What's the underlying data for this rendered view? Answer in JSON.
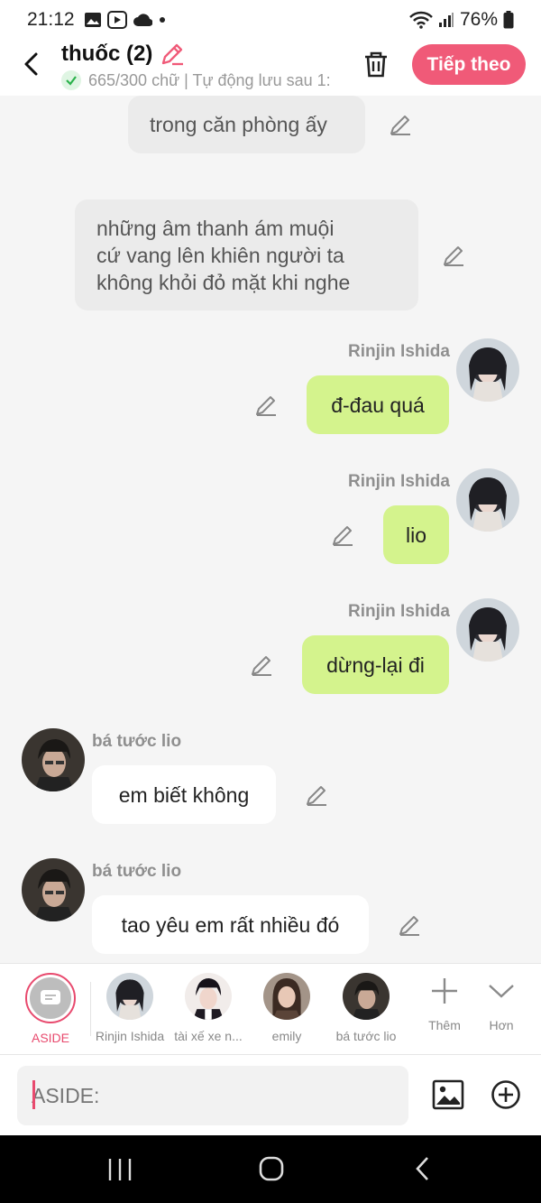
{
  "status": {
    "time": "21:12",
    "battery": "76%"
  },
  "header": {
    "title": "thuốc (2)",
    "subtitle": "665/300 chữ | Tự động lưu sau 1:",
    "next_label": "Tiếp theo"
  },
  "messages": {
    "m1": {
      "text": "trong căn phòng ấy"
    },
    "m2": {
      "lines": [
        "những âm thanh ám muội",
        "cứ vang lên khiên người ta",
        "không khỏi đỏ mặt khi nghe"
      ]
    },
    "m3": {
      "name": "Rinjin Ishida",
      "text": "đ-đau quá"
    },
    "m4": {
      "name": "Rinjin Ishida",
      "text": "lio"
    },
    "m5": {
      "name": "Rinjin Ishida",
      "text": "dừng-lại đi"
    },
    "m6": {
      "name": "bá tước lio",
      "text": "em biết không"
    },
    "m7": {
      "name": "bá tước lio",
      "text": "tao yêu em rất nhiều đó"
    }
  },
  "characters": [
    {
      "label": "ASIDE"
    },
    {
      "label": "Rinjin Ishida"
    },
    {
      "label": "tài xế xe n..."
    },
    {
      "label": "emily"
    },
    {
      "label": "bá tước lio"
    },
    {
      "label": "Thêm"
    },
    {
      "label": "Hơn"
    }
  ],
  "input": {
    "placeholder": "ASIDE:"
  },
  "colors": {
    "accent": "#f05a78",
    "player_bubble": "#d4f38d",
    "narration_bubble": "#ebebeb"
  }
}
